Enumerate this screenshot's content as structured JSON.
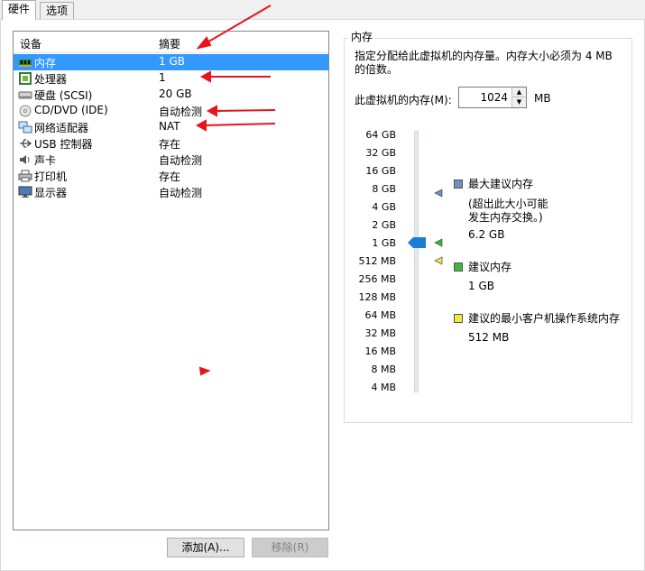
{
  "tabs": [
    {
      "label": "硬件",
      "active": true
    },
    {
      "label": "选项",
      "active": false
    }
  ],
  "device_list": {
    "headers": {
      "device": "设备",
      "summary": "摘要"
    },
    "rows": [
      {
        "icon": "memory-icon",
        "name": "内存",
        "summary": "1 GB",
        "selected": true
      },
      {
        "icon": "processor-icon",
        "name": "处理器",
        "summary": "1",
        "selected": false
      },
      {
        "icon": "hard-disk-icon",
        "name": "硬盘 (SCSI)",
        "summary": "20 GB",
        "selected": false
      },
      {
        "icon": "cd-dvd-icon",
        "name": "CD/DVD (IDE)",
        "summary": "自动检测",
        "selected": false
      },
      {
        "icon": "network-adapter-icon",
        "name": "网络适配器",
        "summary": "NAT",
        "selected": false
      },
      {
        "icon": "usb-icon",
        "name": "USB 控制器",
        "summary": "存在",
        "selected": false
      },
      {
        "icon": "sound-card-icon",
        "name": "声卡",
        "summary": "自动检测",
        "selected": false
      },
      {
        "icon": "printer-icon",
        "name": "打印机",
        "summary": "存在",
        "selected": false
      },
      {
        "icon": "display-icon",
        "name": "显示器",
        "summary": "自动检测",
        "selected": false
      }
    ]
  },
  "buttons": {
    "add": "添加(A)...",
    "remove": "移除(R)"
  },
  "memory_panel": {
    "title": "内存",
    "description": "指定分配给此虚拟机的内存量。内存大小必须为 4 MB 的倍数。",
    "field_label": "此虚拟机的内存(M):",
    "value": "1024",
    "unit": "MB",
    "scale_labels": [
      "64 GB",
      "32 GB",
      "16 GB",
      "8 GB",
      "4 GB",
      "2 GB",
      "1 GB",
      "512 MB",
      "256 MB",
      "128 MB",
      "64 MB",
      "32 MB",
      "16 MB",
      "8 MB",
      "4 MB"
    ],
    "slider_level": "1 GB",
    "legend": {
      "max": {
        "title": "最大建议内存",
        "note_line1": "(超出此大小可能",
        "note_line2": "发生内存交换。)",
        "value": "6.2 GB",
        "color": "#6d8fc7"
      },
      "recommended": {
        "title": "建议内存",
        "value": "1 GB",
        "color": "#3cb93c"
      },
      "min": {
        "title": "建议的最小客户机操作系统内存",
        "value": "512 MB",
        "color": "#f2e640"
      }
    }
  },
  "colors": {
    "selection": "#3399ff",
    "annotation": "#e8141c",
    "thumb": "#1a7fd4"
  }
}
